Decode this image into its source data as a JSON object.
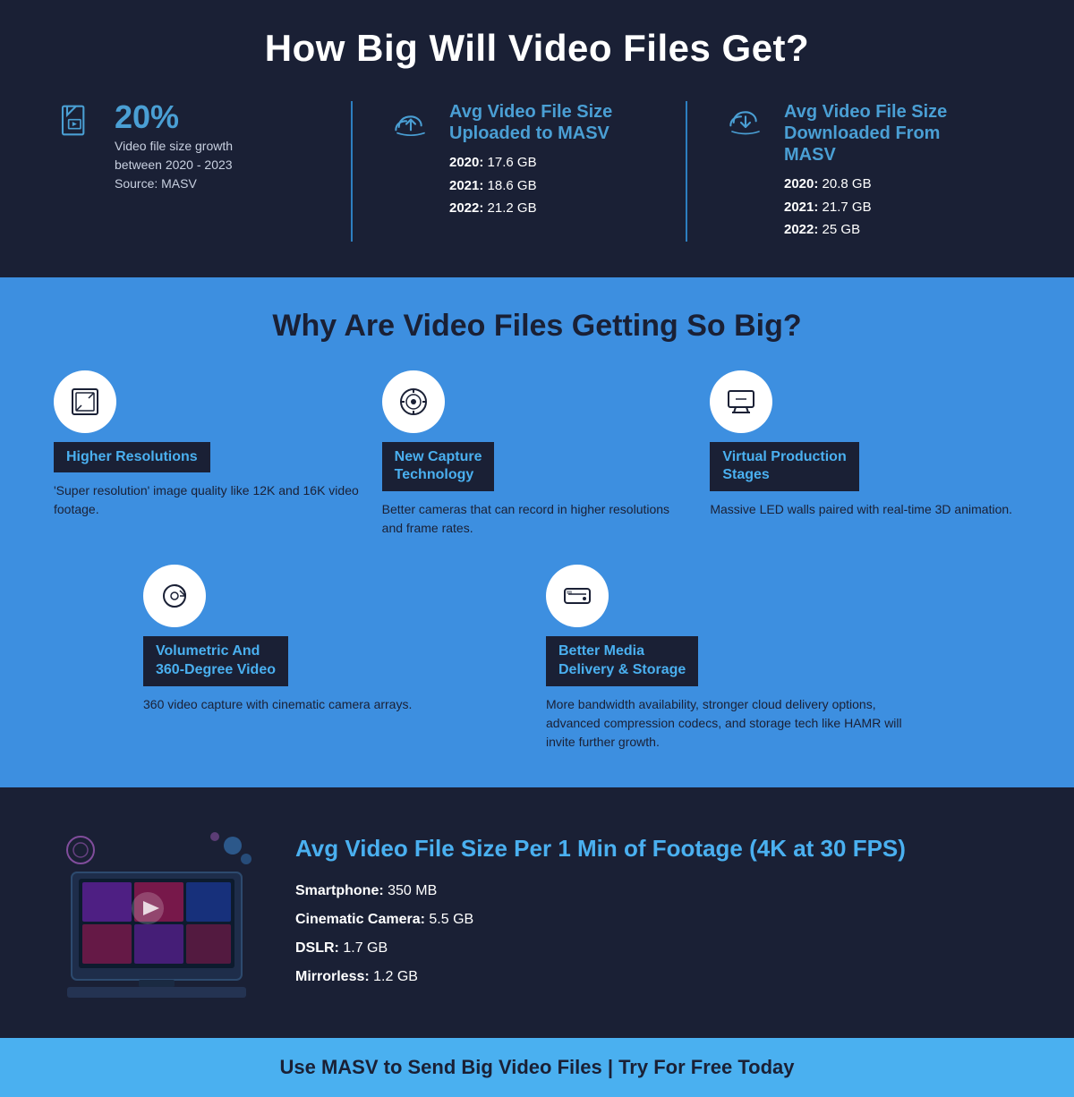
{
  "page": {
    "main_title": "How Big Will Video Files Get?",
    "section2_title": "Why Are Video Files Getting So Big?",
    "footer_text": "Use MASV to Send Big Video Files | Try For Free Today"
  },
  "stats": {
    "growth": {
      "percent": "20%",
      "desc_line1": "Video file size growth",
      "desc_line2": "between 2020 - 2023",
      "desc_line3": "Source: MASV"
    },
    "uploaded": {
      "title_line1": "Avg Video File Size",
      "title_line2": "Uploaded to MASV",
      "y2020_label": "2020:",
      "y2020_val": "17.6 GB",
      "y2021_label": "2021:",
      "y2021_val": "18.6 GB",
      "y2022_label": "2022:",
      "y2022_val": "21.2 GB"
    },
    "downloaded": {
      "title_line1": "Avg Video File Size",
      "title_line2": "Downloaded From MASV",
      "y2020_label": "2020:",
      "y2020_val": "20.8 GB",
      "y2021_label": "2021:",
      "y2021_val": "21.7 GB",
      "y2022_label": "2022:",
      "y2022_val": "25 GB"
    }
  },
  "reasons": {
    "row1": [
      {
        "id": "higher-res",
        "label": "Higher Resolutions",
        "desc": "'Super resolution' image quality like 12K and 16K video footage.",
        "icon": "frame"
      },
      {
        "id": "capture-tech",
        "label_line1": "New Capture",
        "label_line2": "Technology",
        "desc": "Better cameras that can record in higher resolutions and frame rates.",
        "icon": "camera"
      },
      {
        "id": "virtual-prod",
        "label_line1": "Virtual Production",
        "label_line2": "Stages",
        "desc": "Massive LED walls paired with real-time 3D animation.",
        "icon": "monitor"
      }
    ],
    "row2": [
      {
        "id": "volumetric",
        "label_line1": "Volumetric And",
        "label_line2": "360-Degree Video",
        "desc": "360 video capture with cinematic camera arrays.",
        "icon": "rotate"
      },
      {
        "id": "media-delivery",
        "label_line1": "Better Media",
        "label_line2": "Delivery & Storage",
        "desc": "More bandwidth availability, stronger cloud delivery options, advanced compression codecs, and storage tech like HAMR will invite further growth.",
        "icon": "hdd"
      }
    ]
  },
  "bottom": {
    "title": "Avg Video File Size Per 1 Min of Footage (4K at 30 FPS)",
    "items": [
      {
        "device_label": "Smartphone:",
        "value": "350 MB"
      },
      {
        "device_label": "Cinematic Camera:",
        "value": "5.5 GB"
      },
      {
        "device_label": "DSLR:",
        "value": "1.7 GB"
      },
      {
        "device_label": "Mirrorless:",
        "value": "1.2 GB"
      }
    ]
  }
}
